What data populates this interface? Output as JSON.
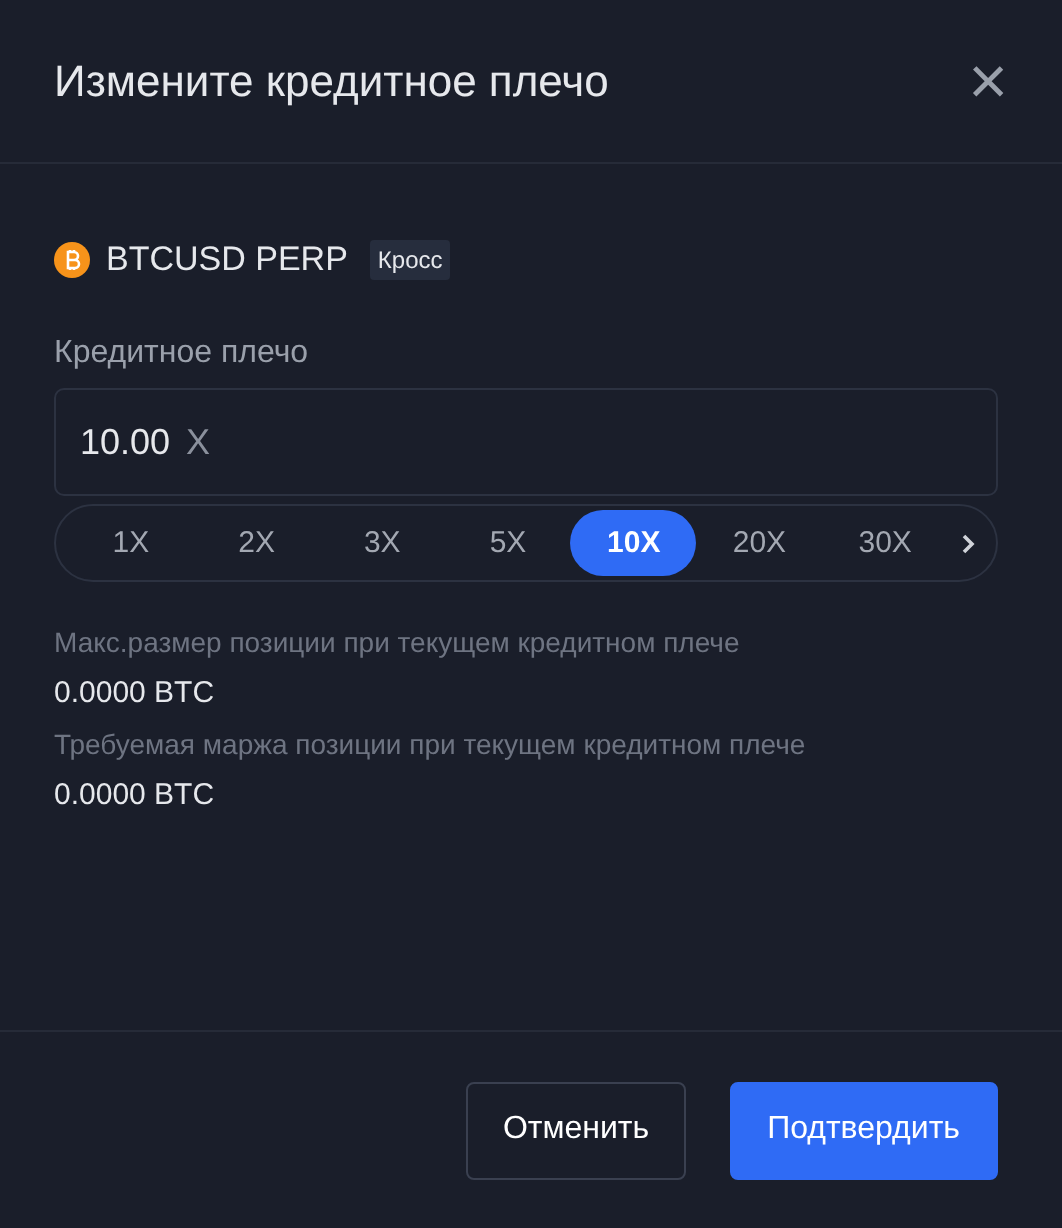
{
  "dialog": {
    "title": "Измените кредитное плечо",
    "close": "×"
  },
  "symbol": {
    "name": "BTCUSD PERP",
    "tag": "Кросс"
  },
  "leverage": {
    "label": "Кредитное плечо",
    "value": "10.00",
    "unit": "X"
  },
  "presets": [
    {
      "label": "1X",
      "selected": false
    },
    {
      "label": "2X",
      "selected": false
    },
    {
      "label": "3X",
      "selected": false
    },
    {
      "label": "5X",
      "selected": false
    },
    {
      "label": "10X",
      "selected": true
    },
    {
      "label": "20X",
      "selected": false
    },
    {
      "label": "30X",
      "selected": false
    }
  ],
  "info": [
    {
      "label": "Макс.размер позиции при текущем кредитном плече",
      "value": "0.0000 BTC"
    },
    {
      "label": "Требуемая маржа позиции при текущем кредитном плече",
      "value": "0.0000 BTC"
    }
  ],
  "buttons": [
    {
      "label": "Отменить",
      "kind": "secondary"
    },
    {
      "label": "Подтвердить",
      "kind": "primary"
    }
  ]
}
